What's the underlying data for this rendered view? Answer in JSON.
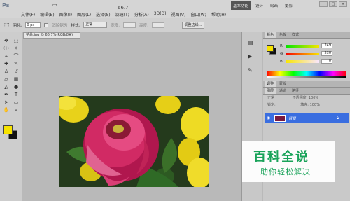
{
  "app": {
    "logo": "Ps",
    "zoom": "66.7"
  },
  "menu": [
    "文件(F)",
    "编辑(E)",
    "图像(I)",
    "图层(L)",
    "选择(S)",
    "滤镜(T)",
    "分析(A)",
    "3D(D)",
    "视图(V)",
    "窗口(W)",
    "帮助(H)"
  ],
  "workspace": {
    "active": "基本功能",
    "items": [
      "设计",
      "绘画",
      "摄影"
    ]
  },
  "options_bar": {
    "feather_label": "羽化:",
    "feather_value": "0 px",
    "antialias_label": "消除锯齿",
    "style_label": "样式:",
    "style_value": "正常",
    "width_label": "宽度:",
    "height_label": "高度:",
    "refine_edge": "调整边缘..."
  },
  "document": {
    "tab_title": "花朵.jpg @ 66.7%(RGB/8#)"
  },
  "color_panel": {
    "tabs": [
      "颜色",
      "色板",
      "样式"
    ],
    "fg_color": "#f7e300",
    "bg_color": "#111111",
    "r": "249",
    "g": "230",
    "b": "0"
  },
  "adjust_panel": {
    "tabs": [
      "调整",
      "蒙版"
    ]
  },
  "layers_panel": {
    "tabs": [
      "图层",
      "通道",
      "路径"
    ],
    "blend_mode": "正常",
    "opacity_label": "不透明度:",
    "opacity_value": "100%",
    "lock_label": "锁定:",
    "fill_label": "填充:",
    "fill_value": "100%",
    "layer_name": "背景"
  },
  "watermark": {
    "title": "百科全说",
    "subtitle": "助你轻松解决"
  }
}
